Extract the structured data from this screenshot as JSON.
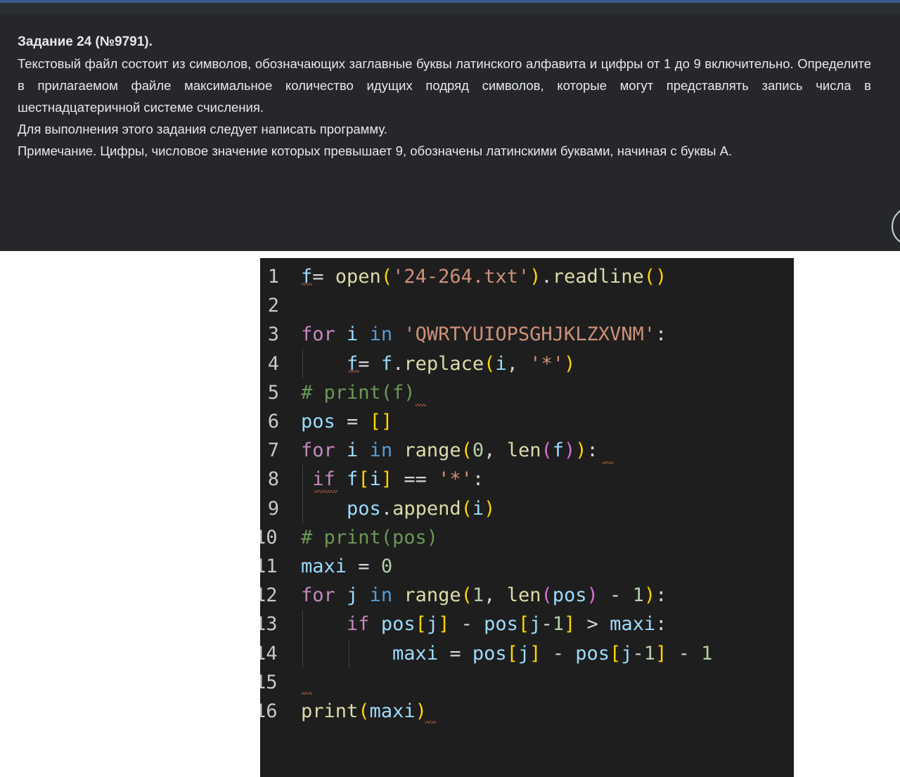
{
  "task": {
    "title": "Задание 24 (№9791).",
    "paragraphs": [
      "Текстовый файл состоит из символов, обозначающих заглавные буквы латинского алфавита и цифры от 1 до 9 включительно. Определите в прилагаемом файле максимальное количество идущих подряд символов, которые могут представлять запись числа в шестнадцатеричной системе счисления.",
      "Для выполнения этого задания следует написать программу.",
      "Примечание. Цифры, числовое значение которых превышает 9, обозначены латинскими буквами, начиная с буквы A."
    ]
  },
  "editor": {
    "line_numbers": [
      "1",
      "2",
      "3",
      "4",
      "5",
      "6",
      "7",
      "8",
      "9",
      "10",
      "11",
      "12",
      "13",
      "14",
      "15",
      "16"
    ],
    "lines": [
      [
        {
          "t": "f",
          "c": "var"
        },
        {
          "t": "= ",
          "c": "op"
        },
        {
          "t": "open",
          "c": "fn"
        },
        {
          "t": "(",
          "c": "p1"
        },
        {
          "t": "'24-264.txt'",
          "c": "str"
        },
        {
          "t": ")",
          "c": "p1"
        },
        {
          "t": ".",
          "c": "op"
        },
        {
          "t": "readline",
          "c": "fn"
        },
        {
          "t": "()",
          "c": "p1"
        }
      ],
      [],
      [
        {
          "t": "for",
          "c": "kw"
        },
        {
          "t": " ",
          "c": "op"
        },
        {
          "t": "i",
          "c": "var"
        },
        {
          "t": " ",
          "c": "op"
        },
        {
          "t": "in",
          "c": "kb"
        },
        {
          "t": " ",
          "c": "op"
        },
        {
          "t": "'QWRTYUIOPSGHJKLZXVNM'",
          "c": "str"
        },
        {
          "t": ":",
          "c": "op"
        }
      ],
      [
        {
          "t": "    ",
          "c": "op"
        },
        {
          "t": "f",
          "c": "var"
        },
        {
          "t": "= ",
          "c": "op"
        },
        {
          "t": "f",
          "c": "var"
        },
        {
          "t": ".",
          "c": "op"
        },
        {
          "t": "replace",
          "c": "fn"
        },
        {
          "t": "(",
          "c": "p1"
        },
        {
          "t": "i",
          "c": "var"
        },
        {
          "t": ", ",
          "c": "op"
        },
        {
          "t": "'*'",
          "c": "str"
        },
        {
          "t": ")",
          "c": "p1"
        }
      ],
      [
        {
          "t": "# print(f)",
          "c": "cmt"
        }
      ],
      [
        {
          "t": "pos",
          "c": "var"
        },
        {
          "t": " = ",
          "c": "op"
        },
        {
          "t": "[]",
          "c": "p1"
        }
      ],
      [
        {
          "t": "for",
          "c": "kw"
        },
        {
          "t": " ",
          "c": "op"
        },
        {
          "t": "i",
          "c": "var"
        },
        {
          "t": " ",
          "c": "op"
        },
        {
          "t": "in",
          "c": "kb"
        },
        {
          "t": " ",
          "c": "op"
        },
        {
          "t": "range",
          "c": "fn"
        },
        {
          "t": "(",
          "c": "p1"
        },
        {
          "t": "0",
          "c": "num"
        },
        {
          "t": ", ",
          "c": "op"
        },
        {
          "t": "len",
          "c": "fn"
        },
        {
          "t": "(",
          "c": "p2"
        },
        {
          "t": "f",
          "c": "var"
        },
        {
          "t": ")",
          "c": "p2"
        },
        {
          "t": ")",
          "c": "p1"
        },
        {
          "t": ":",
          "c": "op"
        }
      ],
      [
        {
          "t": " ",
          "c": "op"
        },
        {
          "t": "if",
          "c": "kw"
        },
        {
          "t": " ",
          "c": "op"
        },
        {
          "t": "f",
          "c": "var"
        },
        {
          "t": "[",
          "c": "p1"
        },
        {
          "t": "i",
          "c": "var"
        },
        {
          "t": "]",
          "c": "p1"
        },
        {
          "t": " == ",
          "c": "op"
        },
        {
          "t": "'*'",
          "c": "str"
        },
        {
          "t": ":",
          "c": "op"
        }
      ],
      [
        {
          "t": "    ",
          "c": "op"
        },
        {
          "t": "pos",
          "c": "var"
        },
        {
          "t": ".",
          "c": "op"
        },
        {
          "t": "append",
          "c": "fn"
        },
        {
          "t": "(",
          "c": "p1"
        },
        {
          "t": "i",
          "c": "var"
        },
        {
          "t": ")",
          "c": "p1"
        }
      ],
      [
        {
          "t": "# print(pos)",
          "c": "cmt"
        }
      ],
      [
        {
          "t": "maxi",
          "c": "var"
        },
        {
          "t": " = ",
          "c": "op"
        },
        {
          "t": "0",
          "c": "num"
        }
      ],
      [
        {
          "t": "for",
          "c": "kw"
        },
        {
          "t": " ",
          "c": "op"
        },
        {
          "t": "j",
          "c": "var"
        },
        {
          "t": " ",
          "c": "op"
        },
        {
          "t": "in",
          "c": "kb"
        },
        {
          "t": " ",
          "c": "op"
        },
        {
          "t": "range",
          "c": "fn"
        },
        {
          "t": "(",
          "c": "p1"
        },
        {
          "t": "1",
          "c": "num"
        },
        {
          "t": ", ",
          "c": "op"
        },
        {
          "t": "len",
          "c": "fn"
        },
        {
          "t": "(",
          "c": "p2"
        },
        {
          "t": "pos",
          "c": "var"
        },
        {
          "t": ")",
          "c": "p2"
        },
        {
          "t": " - ",
          "c": "op"
        },
        {
          "t": "1",
          "c": "num"
        },
        {
          "t": ")",
          "c": "p1"
        },
        {
          "t": ":",
          "c": "op"
        }
      ],
      [
        {
          "t": "    ",
          "c": "op"
        },
        {
          "t": "if",
          "c": "kw"
        },
        {
          "t": " ",
          "c": "op"
        },
        {
          "t": "pos",
          "c": "var"
        },
        {
          "t": "[",
          "c": "p1"
        },
        {
          "t": "j",
          "c": "var"
        },
        {
          "t": "]",
          "c": "p1"
        },
        {
          "t": " - ",
          "c": "op"
        },
        {
          "t": "pos",
          "c": "var"
        },
        {
          "t": "[",
          "c": "p1"
        },
        {
          "t": "j",
          "c": "var"
        },
        {
          "t": "-",
          "c": "op"
        },
        {
          "t": "1",
          "c": "num"
        },
        {
          "t": "]",
          "c": "p1"
        },
        {
          "t": " > ",
          "c": "op"
        },
        {
          "t": "maxi",
          "c": "var"
        },
        {
          "t": ":",
          "c": "op"
        }
      ],
      [
        {
          "t": "        ",
          "c": "op"
        },
        {
          "t": "maxi",
          "c": "var"
        },
        {
          "t": " = ",
          "c": "op"
        },
        {
          "t": "pos",
          "c": "var"
        },
        {
          "t": "[",
          "c": "p1"
        },
        {
          "t": "j",
          "c": "var"
        },
        {
          "t": "]",
          "c": "p1"
        },
        {
          "t": " - ",
          "c": "op"
        },
        {
          "t": "pos",
          "c": "var"
        },
        {
          "t": "[",
          "c": "p1"
        },
        {
          "t": "j",
          "c": "var"
        },
        {
          "t": "-",
          "c": "op"
        },
        {
          "t": "1",
          "c": "num"
        },
        {
          "t": "]",
          "c": "p1"
        },
        {
          "t": " - ",
          "c": "op"
        },
        {
          "t": "1",
          "c": "num"
        }
      ],
      [],
      [
        {
          "t": "print",
          "c": "fn"
        },
        {
          "t": "(",
          "c": "p1"
        },
        {
          "t": "maxi",
          "c": "var"
        },
        {
          "t": ")",
          "c": "p1"
        }
      ]
    ]
  },
  "colors": {
    "panel_bg": "#25272b",
    "editor_bg": "#1e1e1e",
    "keyword": "#c586c0",
    "string": "#ce9178",
    "function": "#dcdcaa",
    "variable": "#9cdcfe",
    "comment": "#6a9955"
  }
}
